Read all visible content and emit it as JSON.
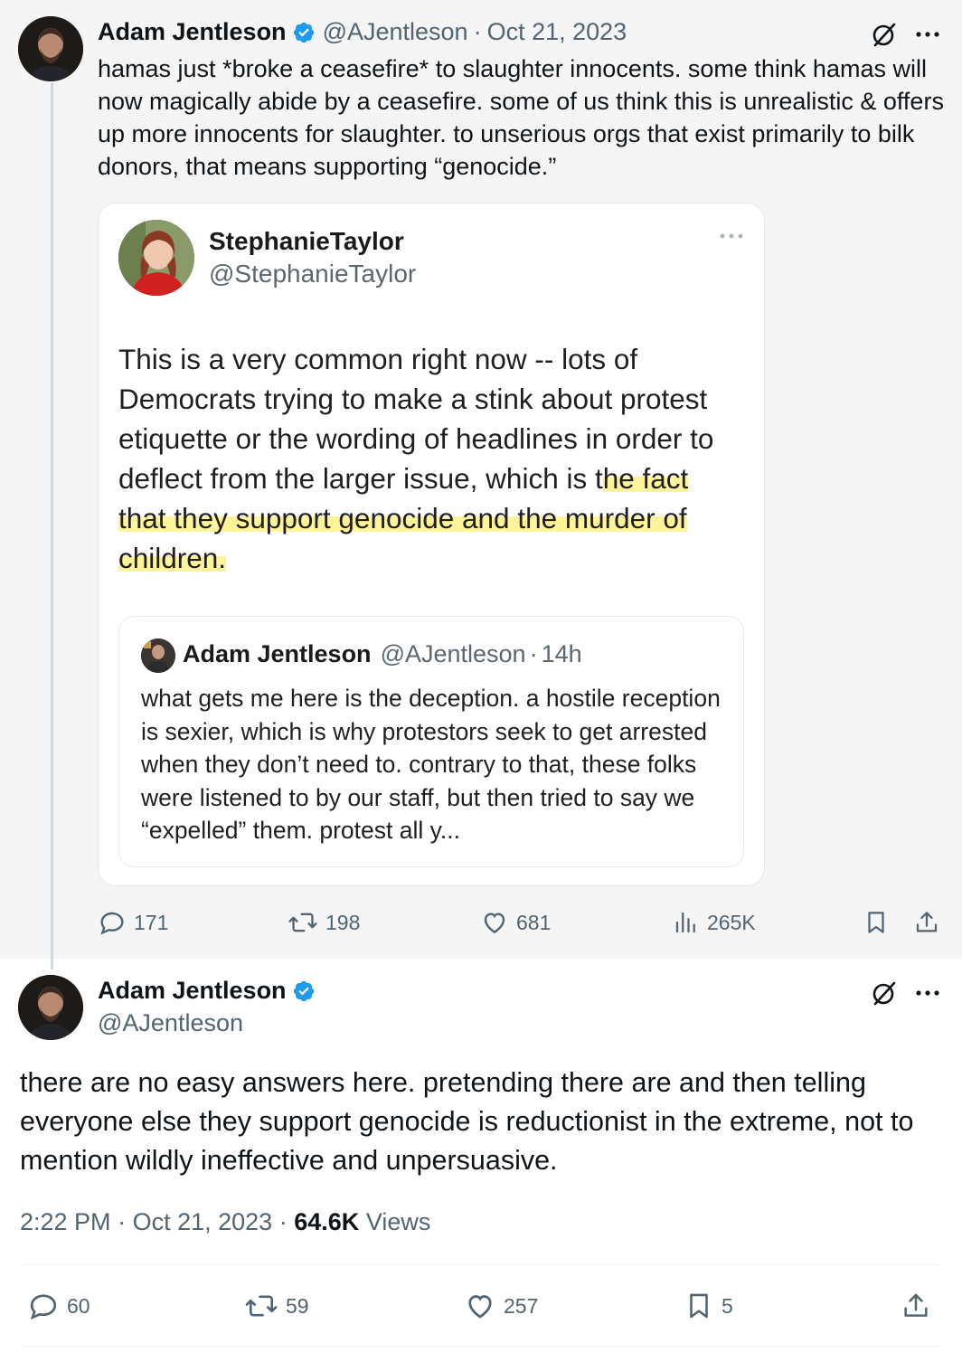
{
  "parent_tweet": {
    "author_name": "Adam Jentleson",
    "handle": "@AJentleson",
    "date": "Oct 21, 2023",
    "text": "hamas just *broke a ceasefire* to slaughter innocents. some think hamas will now magically abide by a ceasefire. some of us think this is unrealistic & offers up more innocents for slaughter. to unserious orgs that exist primarily to bilk donors, that means supporting “genocide.”",
    "replies": "171",
    "reposts": "198",
    "likes": "681",
    "views": "265K"
  },
  "quoted_image": {
    "author_name": "StephanieTaylor",
    "handle": "@StephanieTaylor",
    "text_plain": "This is a very common right now -- lots of Democrats trying to make a stink about protest etiquette or the wording of headlines in order to deflect from the larger issue, which is t",
    "text_highlighted": "he fact that they support genocide and the murder of children.",
    "inner_quote": {
      "author_name": "Adam Jentleson",
      "handle": "@AJentleson",
      "separator": "·",
      "time": "14h",
      "text": "what gets me here is the deception. a hostile reception is sexier, which is why protestors seek to get arrested when they don’t need to. contrary to that, these folks were listened to by our staff, but then tried to say we “expelled” them. protest all y..."
    }
  },
  "focal_tweet": {
    "author_name": "Adam Jentleson",
    "handle": "@AJentleson",
    "text": "there are no easy answers here. pretending there are and then telling everyone else they support genocide is reductionist in the extreme, not to mention wildly ineffective and unpersuasive.",
    "time": "2:22 PM",
    "date": "Oct 21, 2023",
    "views_count": "64.6K",
    "views_label": "Views",
    "replies": "60",
    "reposts": "59",
    "likes": "257",
    "bookmarks": "5"
  },
  "separator": "·",
  "icons": {
    "verified": "verified-badge-icon",
    "grok": "grok-icon",
    "more": "more-icon",
    "reply": "reply-icon",
    "repost": "repost-icon",
    "like": "like-icon",
    "views": "views-icon",
    "bookmark": "bookmark-icon",
    "share": "share-icon"
  },
  "colors": {
    "verified_blue": "#1d9bf0",
    "secondary_text": "#536471",
    "highlight_yellow": "#fff178"
  }
}
